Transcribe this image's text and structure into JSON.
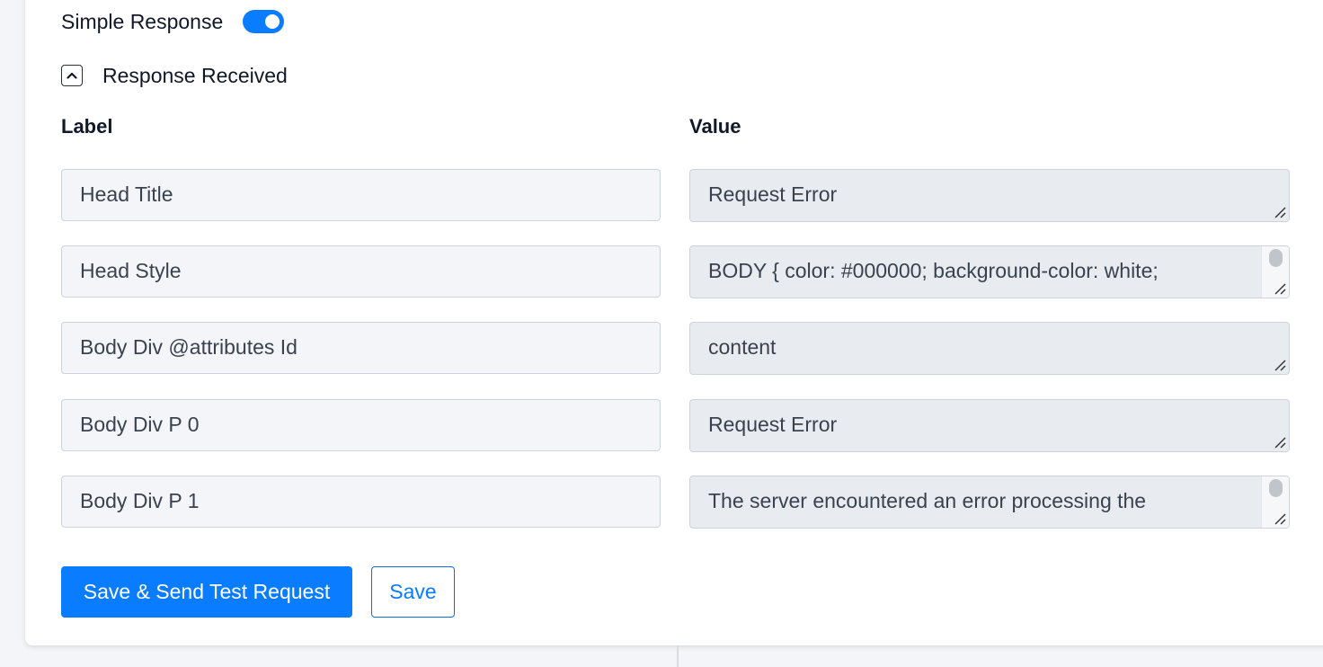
{
  "simple_response": {
    "label": "Simple Response",
    "enabled": true
  },
  "response_section": {
    "title": "Response Received",
    "expanded": true
  },
  "columns": {
    "label_header": "Label",
    "value_header": "Value"
  },
  "rows": [
    {
      "label": "Head Title",
      "value": "Request Error"
    },
    {
      "label": "Head Style",
      "value": "BODY { color: #000000; background-color: white;"
    },
    {
      "label": "Body Div @attributes Id",
      "value": "content"
    },
    {
      "label": "Body Div P 0",
      "value": "Request Error"
    },
    {
      "label": "Body Div P 1",
      "value": "The server encountered an error processing the"
    }
  ],
  "actions": {
    "save_and_send_label": "Save & Send Test Request",
    "save_label": "Save"
  },
  "colors": {
    "accent": "#0a7cff",
    "label_field_bg": "#f3f5f8",
    "value_field_bg": "#e8ebef"
  }
}
